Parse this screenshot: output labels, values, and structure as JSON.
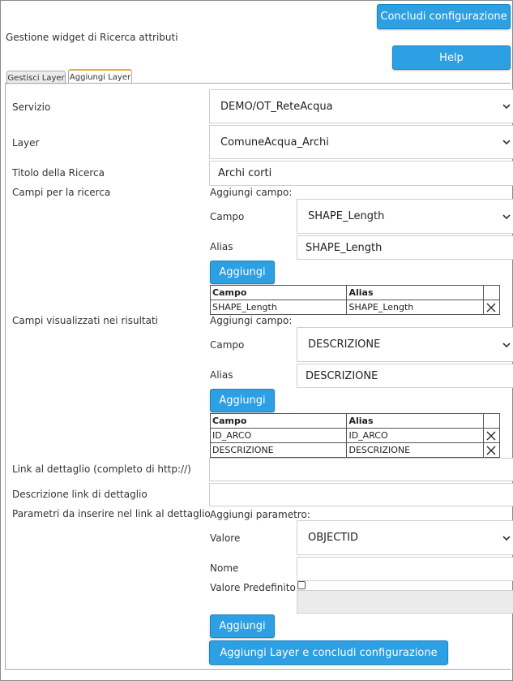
{
  "header": {
    "finish_button": "Concludi configurazione",
    "title": "Gestione widget di Ricerca attributi",
    "help_button": "Help"
  },
  "tabs": [
    {
      "label": "Gestisci Layer",
      "active": false
    },
    {
      "label": "Aggiungi Layer",
      "active": true
    }
  ],
  "form": {
    "servizio": {
      "label": "Servizio",
      "value": "DEMO/OT_ReteAcqua"
    },
    "layer": {
      "label": "Layer",
      "value": "ComuneAcqua_Archi"
    },
    "titolo": {
      "label": "Titolo della Ricerca",
      "value": "Archi corti"
    },
    "campi_ricerca": {
      "label": "Campi per la ricerca",
      "add_label": "Aggiungi campo:",
      "campo_label": "Campo",
      "campo_value": "SHAPE_Length",
      "alias_label": "Alias",
      "alias_value": "SHAPE_Length",
      "add_button": "Aggiungi",
      "table_headers": [
        "Campo",
        "Alias"
      ],
      "rows": [
        [
          "SHAPE_Length",
          "SHAPE_Length"
        ]
      ]
    },
    "campi_visualizzati": {
      "label": "Campi visualizzati nei risultati",
      "add_label": "Aggiungi campo:",
      "campo_label": "Campo",
      "campo_value": "DESCRIZIONE",
      "alias_label": "Alias",
      "alias_value": "DESCRIZIONE",
      "add_button": "Aggiungi",
      "table_headers": [
        "Campo",
        "Alias"
      ],
      "rows": [
        [
          "ID_ARCO",
          "ID_ARCO"
        ],
        [
          "DESCRIZIONE",
          "DESCRIZIONE"
        ]
      ]
    },
    "link_dettaglio": {
      "label": "Link al dettaglio (completo di http://)",
      "value": ""
    },
    "descrizione_link": {
      "label": "Descrizione link di dettaglio",
      "value": ""
    },
    "parametri": {
      "label": "Parametri da inserire nel link al dettaglio",
      "add_label": "Aggiungi parametro:",
      "valore_label": "Valore",
      "valore_value": "OBJECTID",
      "nome_label": "Nome",
      "nome_value": "",
      "predef_label": "Valore Predefinito",
      "add_button": "Aggiungi"
    },
    "submit_button": "Aggiungi Layer e concludi configurazione"
  },
  "colors": {
    "button": "#2d9fe3",
    "tab_accent": "#f0a830"
  }
}
